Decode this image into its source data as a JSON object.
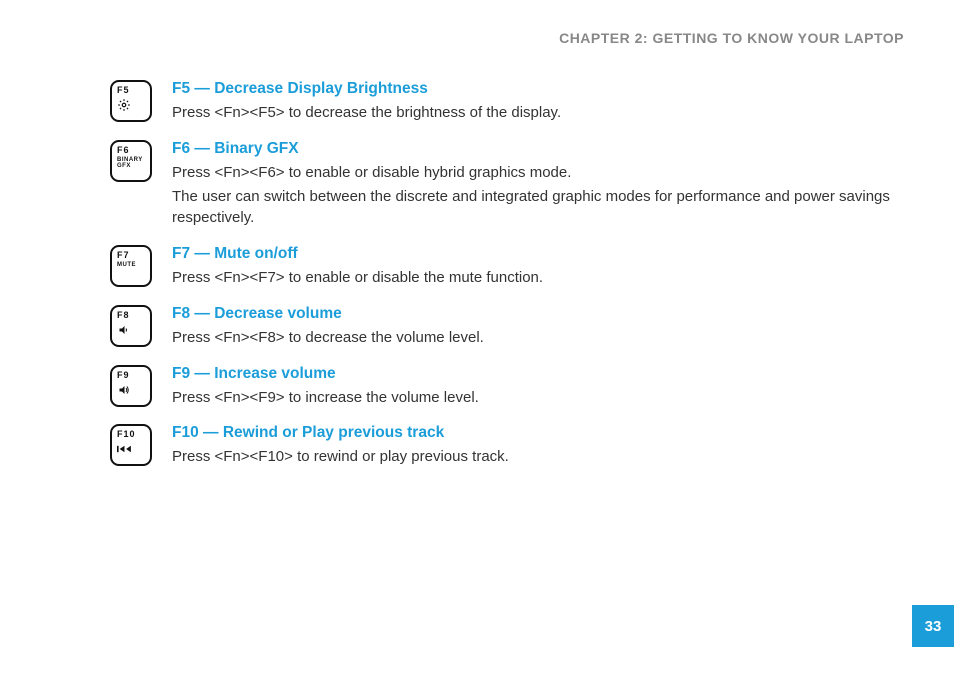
{
  "header": {
    "chapter": "CHAPTER 2: GETTING TO KNOW YOUR LAPTOP"
  },
  "page_number": "33",
  "items": [
    {
      "key_label": "F5",
      "key_sub": "",
      "icon": "brightness-down",
      "title": "F5 — Decrease Display Brightness",
      "desc": [
        "Press <Fn><F5> to decrease the brightness of the display."
      ]
    },
    {
      "key_label": "F6",
      "key_sub": "BINARY GFX",
      "icon": "",
      "title": "F6 — Binary GFX",
      "desc": [
        "Press <Fn><F6> to enable or disable hybrid graphics mode.",
        "The user can switch between the discrete and integrated graphic modes for performance and power savings respectively."
      ]
    },
    {
      "key_label": "F7",
      "key_sub": "MUTE",
      "icon": "",
      "title": "F7 — Mute on/off",
      "desc": [
        "Press <Fn><F7> to enable or disable the mute function."
      ]
    },
    {
      "key_label": "F8",
      "key_sub": "",
      "icon": "vol-down",
      "title": "F8 — Decrease volume",
      "desc": [
        "Press <Fn><F8> to decrease the volume level."
      ]
    },
    {
      "key_label": "F9",
      "key_sub": "",
      "icon": "vol-up",
      "title": "F9 — Increase volume",
      "desc": [
        "Press <Fn><F9> to increase the volume level."
      ]
    },
    {
      "key_label": "F10",
      "key_sub": "",
      "icon": "prev-track",
      "title": "F10 — Rewind or Play previous track",
      "desc": [
        "Press <Fn><F10> to rewind or play previous track."
      ]
    }
  ]
}
